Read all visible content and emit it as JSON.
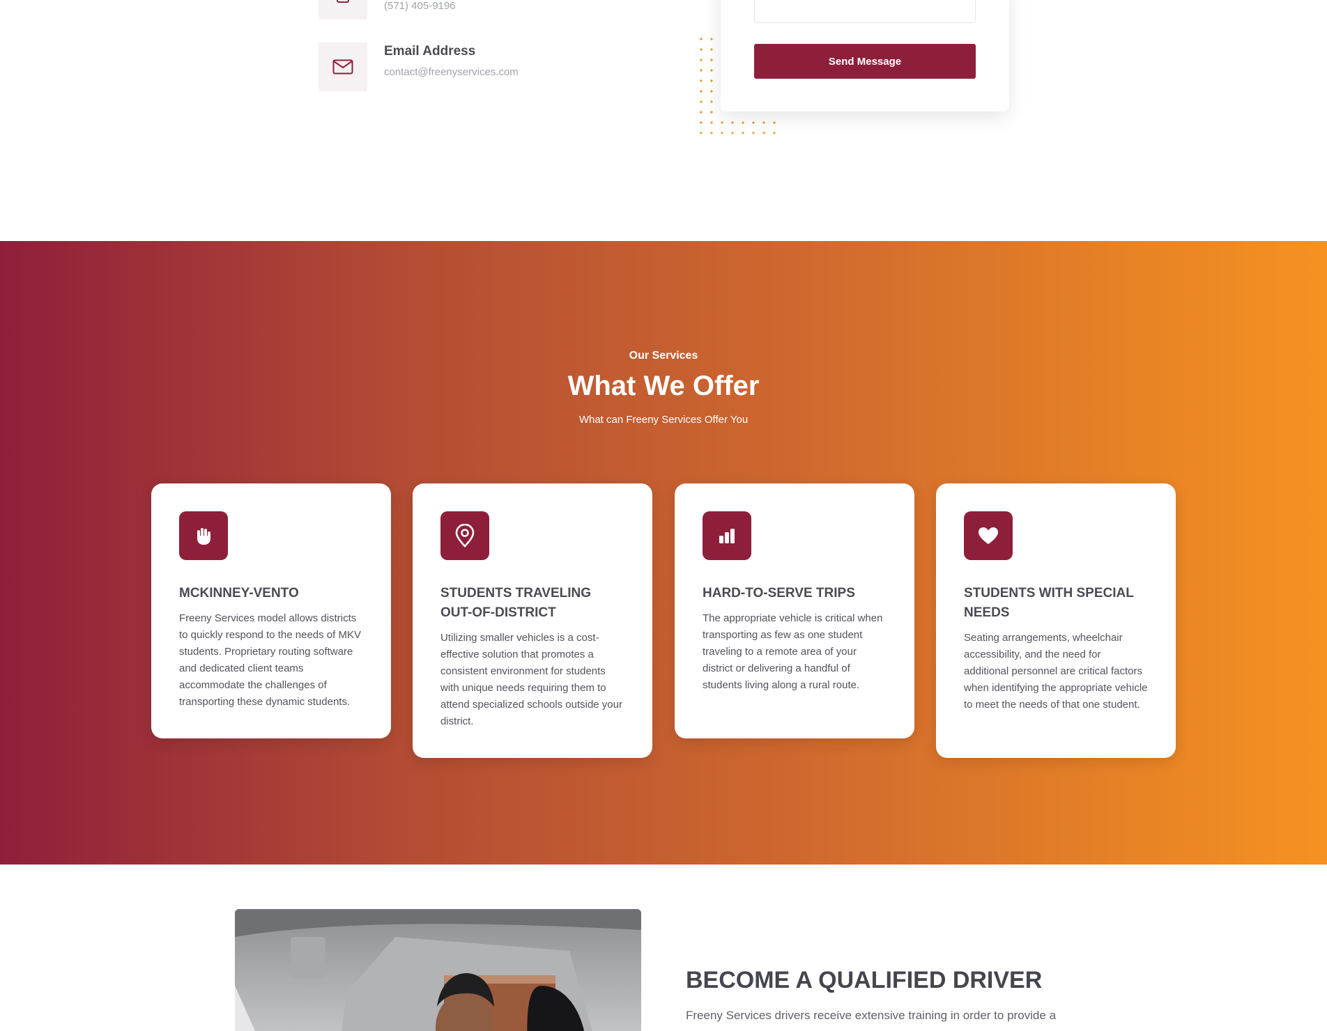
{
  "contact": {
    "phone": {
      "value": "(571) 405-9196",
      "icon": "phone-icon"
    },
    "email": {
      "title": "Email Address",
      "value": "contact@freenyservices.com",
      "icon": "envelope-icon"
    },
    "form": {
      "send_label": "Send Message"
    }
  },
  "services": {
    "eyebrow": "Our Services",
    "heading": "What We Offer",
    "subheading": "What can Freeny Services Offer You",
    "cards": [
      {
        "icon": "hand-icon",
        "title": "MCKINNEY-VENTO",
        "desc": "Freeny Services model allows districts to quickly respond to the needs of MKV students. Proprietary routing software and dedicated client teams accommodate the challenges of transporting these dynamic students."
      },
      {
        "icon": "location-pin-icon",
        "title": "STUDENTS TRAVELING OUT-OF-DISTRICT",
        "desc": "Utilizing smaller vehicles is a cost-effective solution that promotes a consistent environment for students with unique needs requiring them to attend specialized schools outside your district."
      },
      {
        "icon": "bar-chart-icon",
        "title": "HARD-TO-SERVE TRIPS",
        "desc": "The appropriate vehicle is critical when transporting as few as one student traveling to a remote area of your district or delivering a handful of students living along a rural route."
      },
      {
        "icon": "heart-icon",
        "title": "STUDENTS WITH SPECIAL NEEDS",
        "desc": "Seating arrangements, wheelchair accessibility, and the need for additional personnel are critical factors when identifying the appropriate vehicle to meet the needs of that one student."
      }
    ]
  },
  "driver": {
    "title": "BECOME A QUALIFIED DRIVER",
    "desc": "Freeny Services drivers receive extensive training in order to provide a"
  },
  "colors": {
    "brand": "#8e1f3b",
    "gradient_end": "#f59221",
    "dots": "#f59221"
  }
}
